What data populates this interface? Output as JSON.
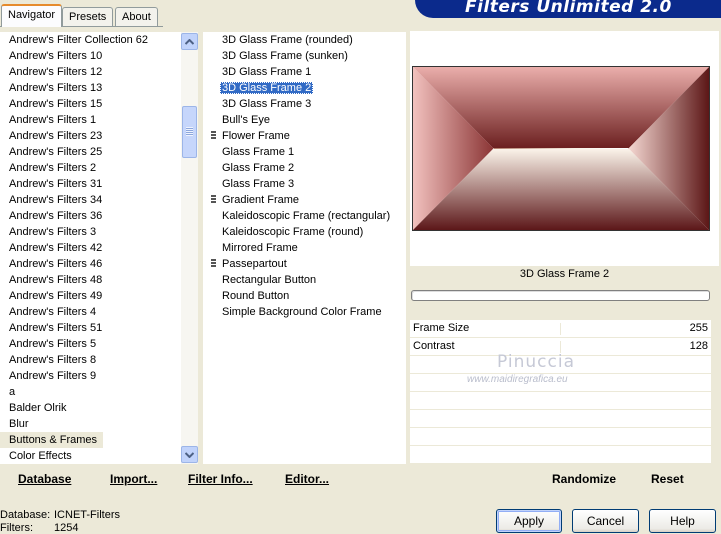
{
  "tabs": [
    {
      "label": "Navigator",
      "active": true
    },
    {
      "label": "Presets",
      "active": false
    },
    {
      "label": "About",
      "active": false
    }
  ],
  "app_title": "Filters Unlimited 2.0",
  "categories": [
    "Andrew's Filter Collection 62",
    "Andrew's Filters 10",
    "Andrew's Filters 12",
    "Andrew's Filters 13",
    "Andrew's Filters 15",
    "Andrew's Filters 1",
    "Andrew's Filters 23",
    "Andrew's Filters 25",
    "Andrew's Filters 2",
    "Andrew's Filters 31",
    "Andrew's Filters 34",
    "Andrew's Filters 36",
    "Andrew's Filters 3",
    "Andrew's Filters 42",
    "Andrew's Filters 46",
    "Andrew's Filters 48",
    "Andrew's Filters 49",
    "Andrew's Filters 4",
    "Andrew's Filters 51",
    "Andrew's Filters 5",
    "Andrew's Filters 8",
    "Andrew's Filters 9",
    "a",
    "Balder Olrik",
    "Blur",
    "Buttons & Frames",
    "Color Effects"
  ],
  "highlighted_category": "Buttons & Frames",
  "filters": [
    {
      "label": "3D Glass Frame (rounded)",
      "marker": false
    },
    {
      "label": "3D Glass Frame (sunken)",
      "marker": false
    },
    {
      "label": "3D Glass Frame 1",
      "marker": false
    },
    {
      "label": "3D Glass Frame 2",
      "marker": false
    },
    {
      "label": "3D Glass Frame 3",
      "marker": false
    },
    {
      "label": "Bull's Eye",
      "marker": false
    },
    {
      "label": "Flower Frame",
      "marker": true
    },
    {
      "label": "Glass Frame 1",
      "marker": false
    },
    {
      "label": "Glass Frame 2",
      "marker": false
    },
    {
      "label": "Glass Frame 3",
      "marker": false
    },
    {
      "label": "Gradient Frame",
      "marker": true
    },
    {
      "label": "Kaleidoscopic Frame (rectangular)",
      "marker": false
    },
    {
      "label": "Kaleidoscopic Frame (round)",
      "marker": false
    },
    {
      "label": "Mirrored Frame",
      "marker": false
    },
    {
      "label": "Passepartout",
      "marker": true
    },
    {
      "label": "Rectangular Button",
      "marker": false
    },
    {
      "label": "Round Button",
      "marker": false
    },
    {
      "label": "Simple Background Color Frame",
      "marker": false
    }
  ],
  "selected_filter": "3D Glass Frame 2",
  "toolbar": {
    "database": "Database",
    "import": "Import...",
    "filter_info": "Filter Info...",
    "editor": "Editor...",
    "randomize": "Randomize",
    "reset": "Reset"
  },
  "effect_name": "3D Glass Frame 2",
  "params": [
    {
      "label": "Frame Size",
      "value": "255"
    },
    {
      "label": "Contrast",
      "value": "128"
    }
  ],
  "watermark": {
    "name": "Pinuccia",
    "url": "www.maidiregrafica.eu"
  },
  "footer": {
    "database_label": "Database:",
    "database_value": "ICNET-Filters",
    "filters_label": "Filters:",
    "filters_value": "1254"
  },
  "buttons": {
    "apply": "Apply",
    "cancel": "Cancel",
    "help": "Help"
  },
  "colors": {
    "selection": "#316ac5",
    "banner": "#0b2a8c",
    "background": "#ece9d8"
  }
}
